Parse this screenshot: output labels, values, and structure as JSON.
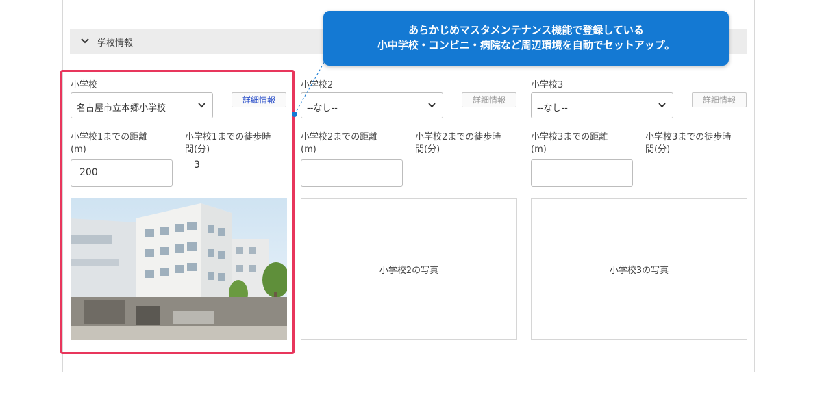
{
  "section": {
    "title": "学校情報",
    "icon": "chevron-down-icon"
  },
  "callout": {
    "line1": "あらかじめマスタメンテナンス機能で登録している",
    "line2": "小中学校・コンビニ・病院など周辺環境を自動でセットアップ。"
  },
  "colors": {
    "callout": "#1479d3",
    "highlight": "#e8365c",
    "section_bar": "#ececec"
  },
  "schools": [
    {
      "label": "小学校",
      "selected": "名古屋市立本郷小学校",
      "detail_button": "詳細情報",
      "detail_enabled": true,
      "distance_label_1": "小学校1までの距離",
      "distance_label_2": "(m)",
      "distance_value": "200",
      "walk_label_1": "小学校1までの徒歩時",
      "walk_label_2": "間(分)",
      "walk_value": "3",
      "photo_caption": ""
    },
    {
      "label": "小学校2",
      "selected": "--なし--",
      "detail_button": "詳細情報",
      "detail_enabled": false,
      "distance_label_1": "小学校2までの距離",
      "distance_label_2": "(m)",
      "distance_value": "",
      "walk_label_1": "小学校2までの徒歩時",
      "walk_label_2": "間(分)",
      "walk_value": "",
      "photo_caption": "小学校2の写真"
    },
    {
      "label": "小学校3",
      "selected": "--なし--",
      "detail_button": "詳細情報",
      "detail_enabled": false,
      "distance_label_1": "小学校3までの距離",
      "distance_label_2": "(m)",
      "distance_value": "",
      "walk_label_1": "小学校3までの徒歩時",
      "walk_label_2": "間(分)",
      "walk_value": "",
      "photo_caption": "小学校3の写真"
    }
  ]
}
